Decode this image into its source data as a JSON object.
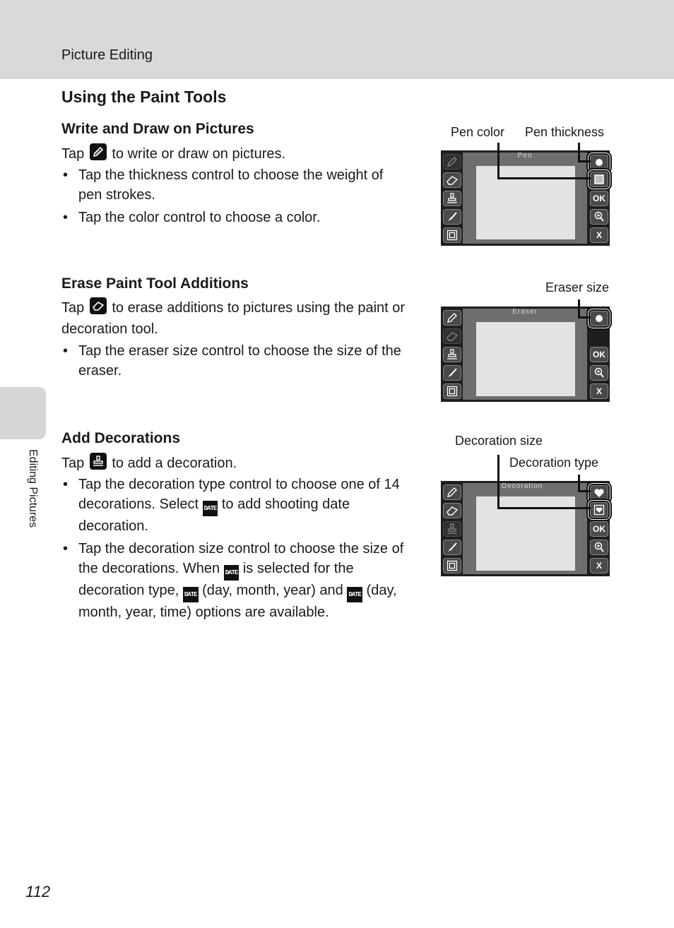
{
  "header": {
    "running_head": "Picture Editing"
  },
  "side_tab": {
    "label": "Editing Pictures"
  },
  "page_number": "112",
  "title": "Using the Paint Tools",
  "sections": [
    {
      "heading": "Write and Draw on Pictures",
      "intro_before": "Tap",
      "intro_icon": "pencil-icon",
      "intro_after": "to write or draw on pictures.",
      "bullets": [
        "Tap the thickness control to choose the weight of pen strokes.",
        "Tap the color control to choose a color."
      ],
      "screen": {
        "mode_label": "Pen",
        "callouts": [
          "Pen color",
          "Pen thickness"
        ]
      }
    },
    {
      "heading": "Erase Paint Tool Additions",
      "intro_before": "Tap",
      "intro_icon": "eraser-icon",
      "intro_after": "to erase additions to pictures using the paint or decoration tool.",
      "bullets": [
        "Tap the eraser size control to choose the size of the eraser."
      ],
      "screen": {
        "mode_label": "Eraser",
        "callouts": [
          "Eraser size"
        ]
      }
    },
    {
      "heading": "Add Decorations",
      "intro_before": "Tap",
      "intro_icon": "stamp-icon",
      "intro_after": "to add a decoration.",
      "bullet1": {
        "a": "Tap the decoration type control to choose one of 14 decorations. Select",
        "b": "to add shooting date decoration."
      },
      "bullet2": {
        "a": "Tap the decoration size control to choose the size of the decorations. When",
        "b": "is selected for the decoration type,",
        "c": "(day, month, year) and",
        "d": "(day, month, year, time) options are available."
      },
      "date_icon_label": "DATE",
      "screen": {
        "mode_label": "Decoration",
        "callouts": [
          "Decoration size",
          "Decoration type"
        ]
      }
    }
  ],
  "screen_buttons": {
    "ok": "OK",
    "close": "X"
  }
}
